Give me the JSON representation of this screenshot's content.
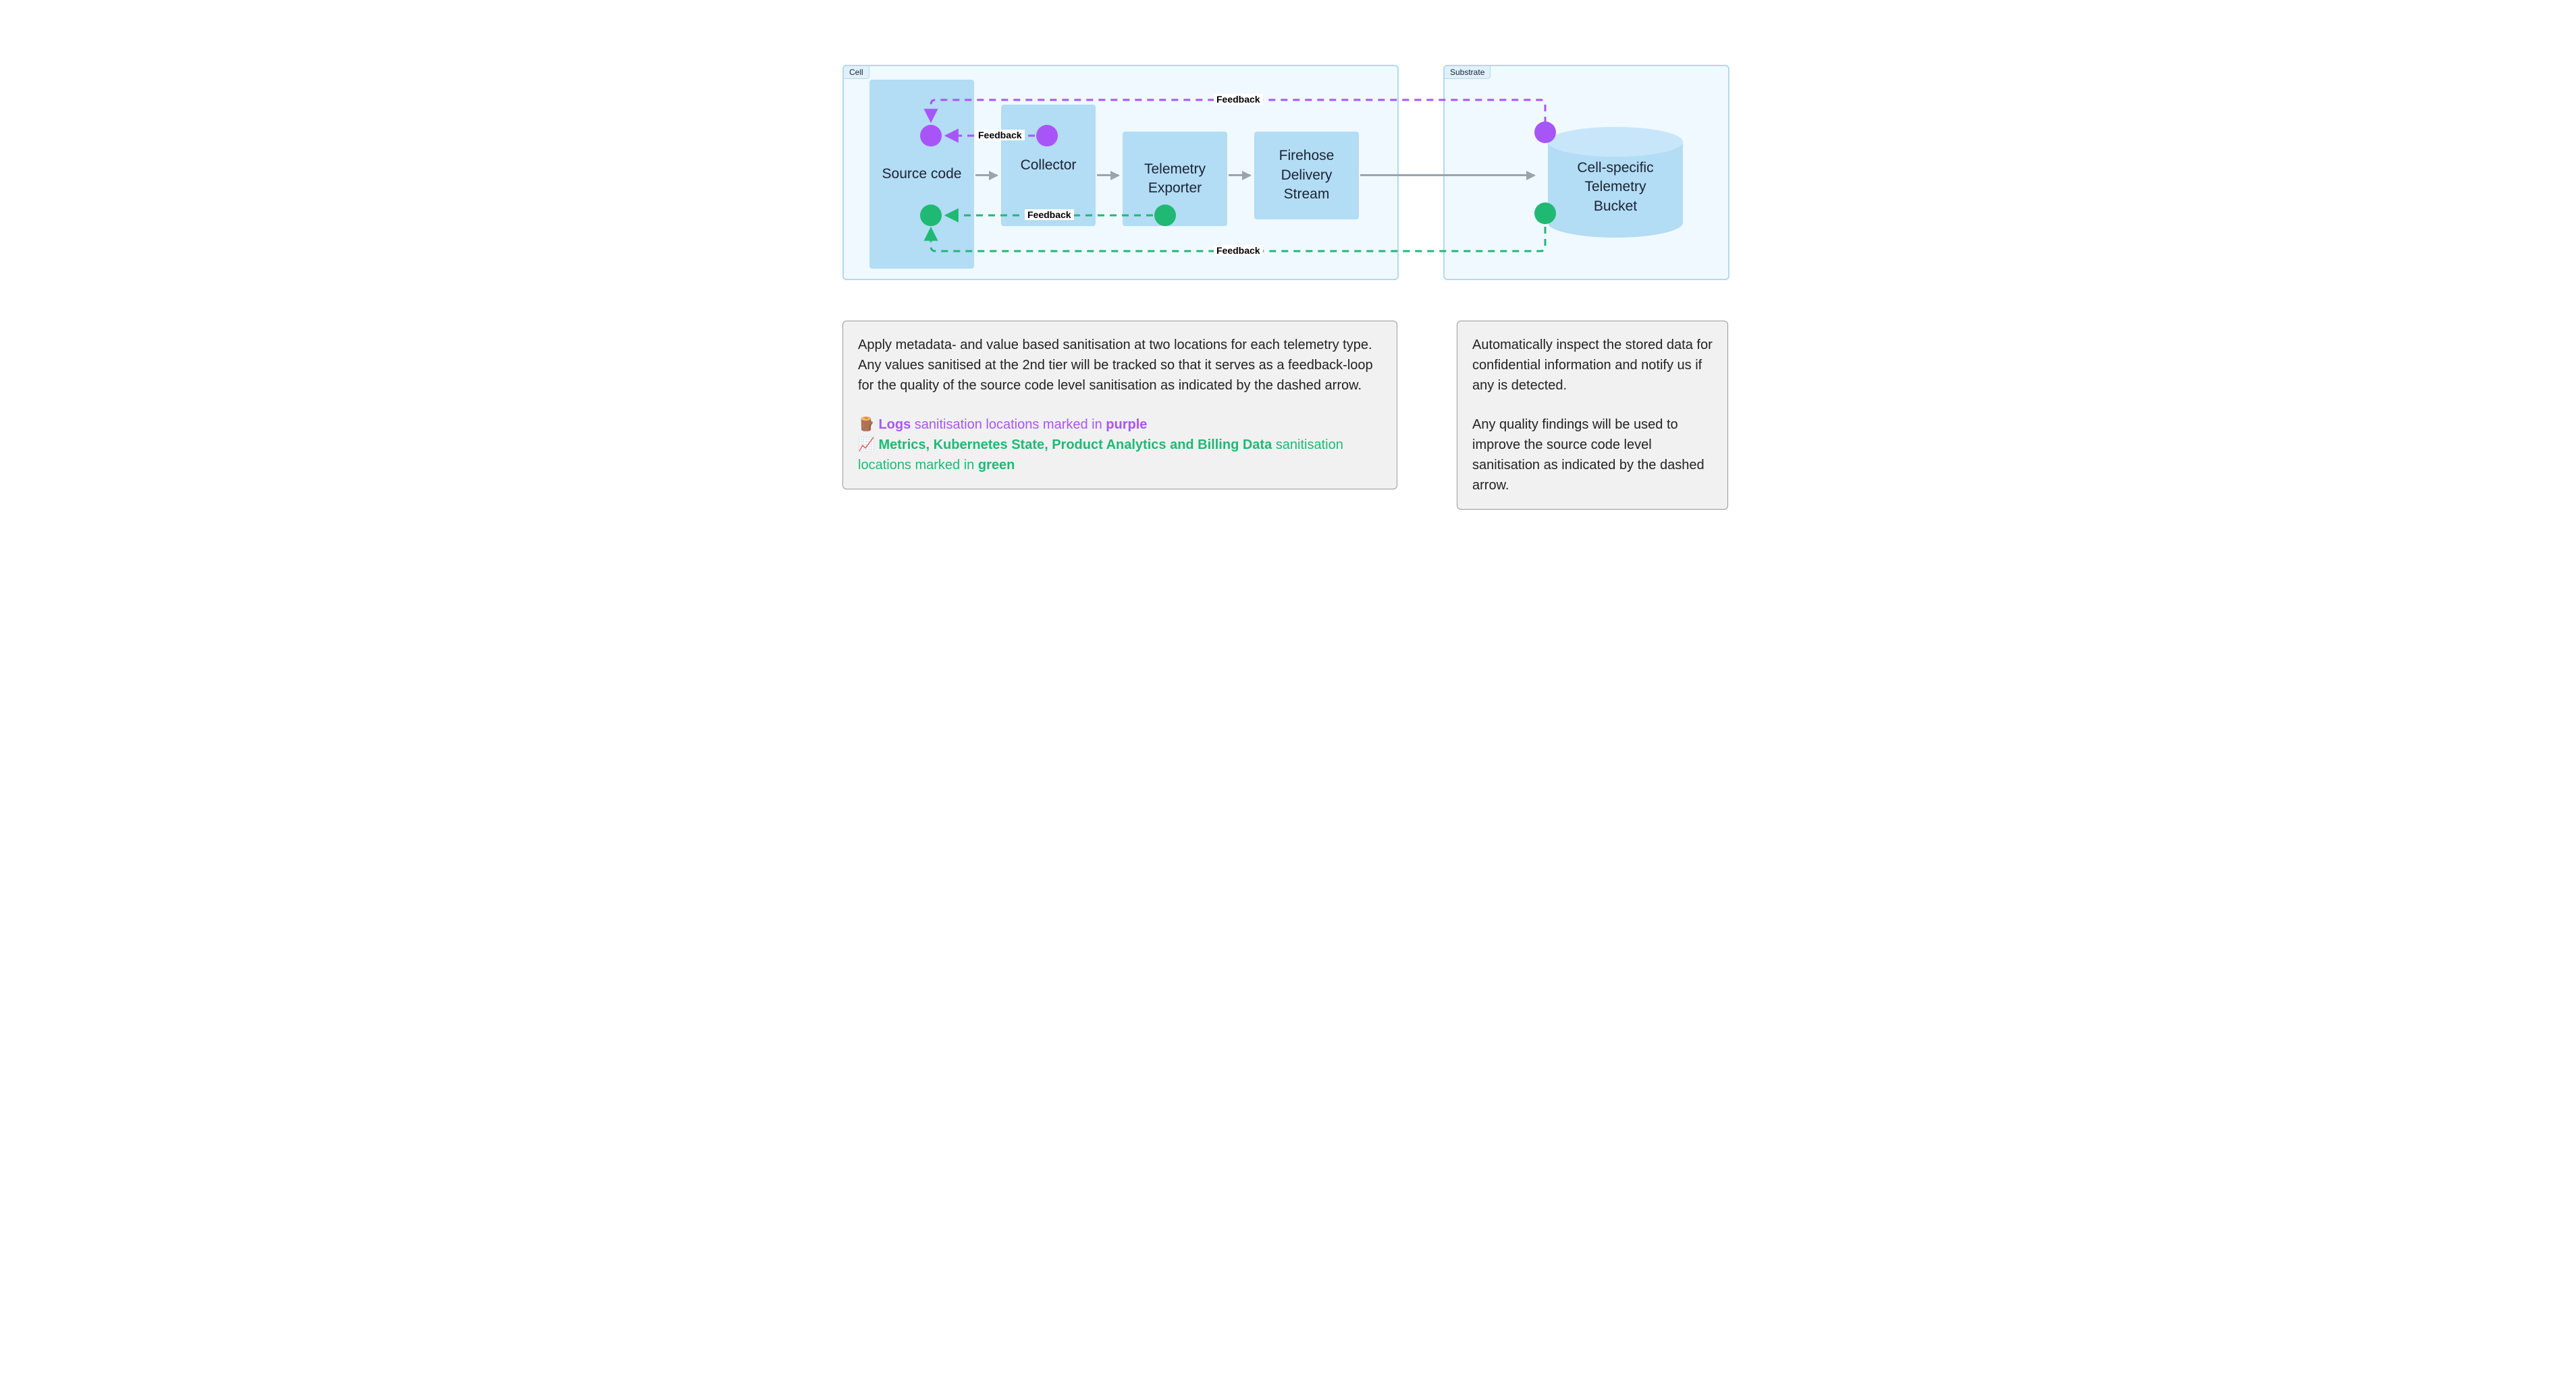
{
  "zones": {
    "cell": {
      "label": "Cell"
    },
    "substrate": {
      "label": "Substrate"
    }
  },
  "components": {
    "source_code": "Source code",
    "collector": "Collector",
    "telemetry_exporter": "Telemetry\nExporter",
    "firehose": "Firehose\nDelivery\nStream",
    "bucket": "Cell-specific\nTelemetry\nBucket"
  },
  "feedback_labels": {
    "top_long": "Feedback",
    "purple_short": "Feedback",
    "green_short": "Feedback",
    "bottom_long": "Feedback"
  },
  "notes": {
    "left": {
      "p1": "Apply metadata- and value based sanitisation at two locations for each telemetry type. Any values sanitised at the 2nd tier will be tracked so that it serves as a feedback-loop for the quality of the source code level sanitisation as indicated by the dashed arrow.",
      "logs_emoji": "🪵",
      "logs_bold": "Logs",
      "logs_rest": " sanitisation locations marked in ",
      "logs_color": "purple",
      "metrics_emoji": "📈",
      "metrics_bold": "Metrics, Kubernetes State, Product Analytics and Billing Data",
      "metrics_rest": " sanitisation locations marked in ",
      "metrics_color": "green"
    },
    "right": {
      "p1": "Automatically inspect the stored data for confidential information and notify us if any is detected.",
      "p2": "Any quality findings will be used to improve the source code level sanitisation as indicated by the dashed arrow."
    }
  },
  "colors": {
    "purple": "#a855f7",
    "green": "#1fb974"
  }
}
